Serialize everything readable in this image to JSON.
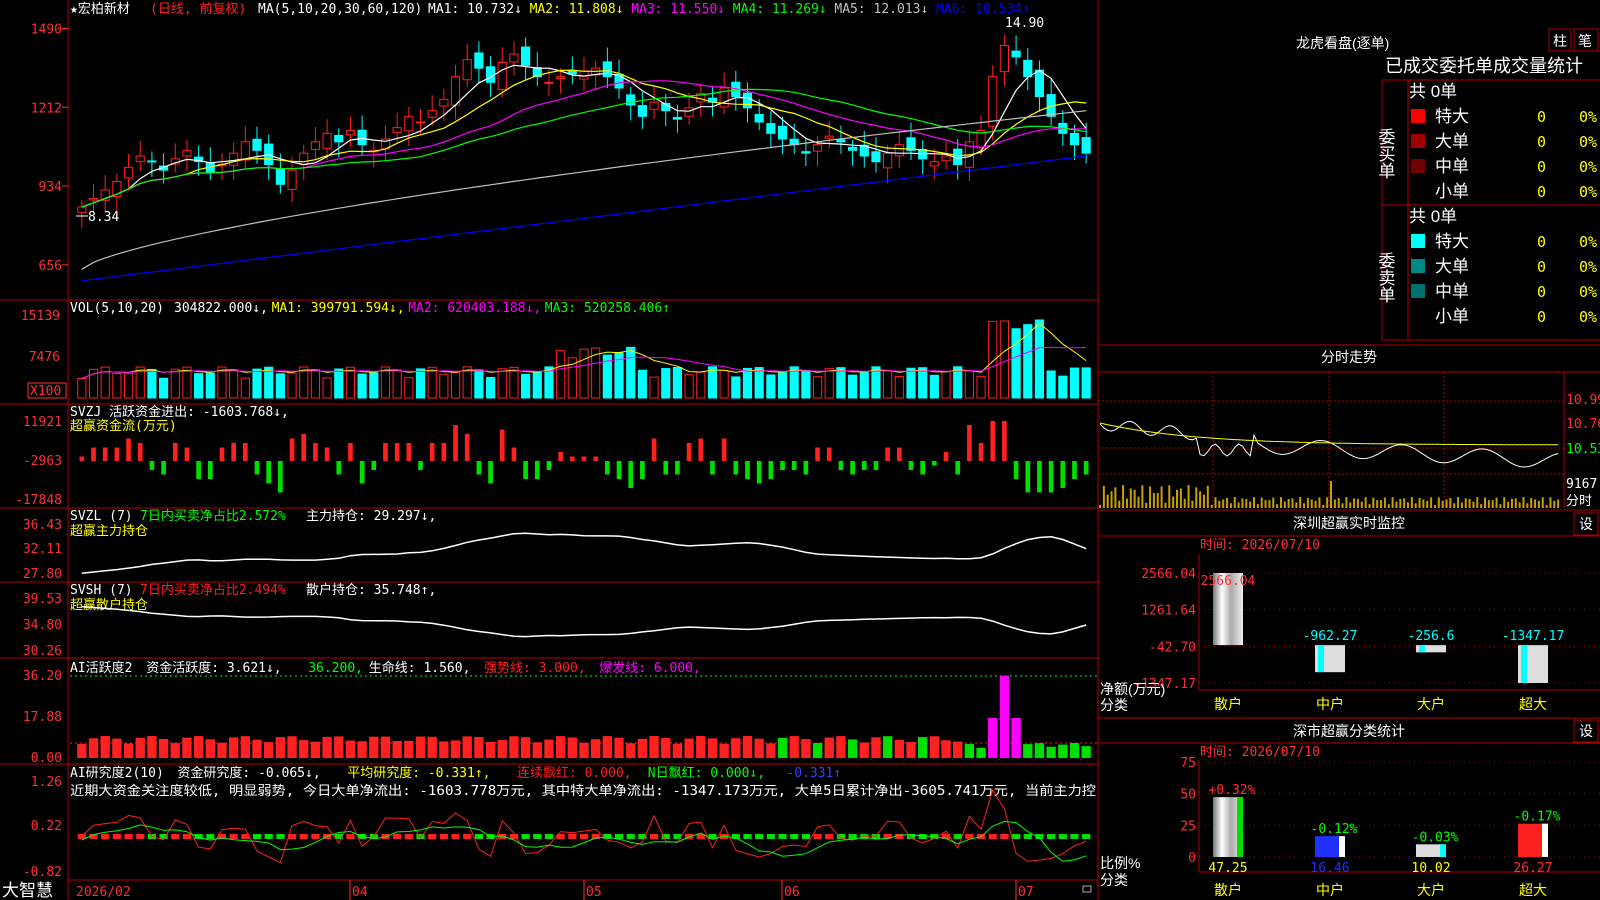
{
  "header": {
    "stock": "★宏柏新材",
    "mode": "(日线, 前复权)",
    "ma_title": "MA(5,10,20,30,60,120)",
    "ma": [
      {
        "text": "MA1: 10.732↓",
        "color": "#ffffff"
      },
      {
        "text": "MA2: 11.808↓",
        "color": "#ffff00"
      },
      {
        "text": "MA3: 11.550↓",
        "color": "#ff00ff"
      },
      {
        "text": "MA4: 11.269↓",
        "color": "#00ff00"
      },
      {
        "text": "MA5: 12.013↓",
        "color": "#c0c0c0"
      },
      {
        "text": "MA6: 10.534↑",
        "color": "#0000ff"
      }
    ]
  },
  "colors": {
    "up": "#ff2020",
    "down": "#00ffff",
    "grid": "#b00000",
    "axis_text": "#ff3030",
    "green": "#00e000",
    "yellow": "#ffff00",
    "magenta": "#ff00ff"
  },
  "price_panel": {
    "ticks": [
      "1490",
      "1212",
      "934",
      "656"
    ],
    "high_label": "14.90",
    "low_label": "8.34",
    "ylim": [
      5.6,
      15.2
    ],
    "closes": [
      8.6,
      8.9,
      9.2,
      9.5,
      10.0,
      10.4,
      10.2,
      9.9,
      10.3,
      10.6,
      10.2,
      9.8,
      10.1,
      10.5,
      10.9,
      10.6,
      10.1,
      9.4,
      9.9,
      10.5,
      10.9,
      11.2,
      10.9,
      11.3,
      10.8,
      10.6,
      11.0,
      11.4,
      11.8,
      11.6,
      12.0,
      12.4,
      13.2,
      13.8,
      13.5,
      13.0,
      13.7,
      14.0,
      13.6,
      13.2,
      13.0,
      13.2,
      13.3,
      13.4,
      13.5,
      13.2,
      12.8,
      12.2,
      11.8,
      12.3,
      12.0,
      11.7,
      12.1,
      12.6,
      12.3,
      12.8,
      12.5,
      12.1,
      11.6,
      11.2,
      11.0,
      10.8,
      10.5,
      10.8,
      11.1,
      10.9,
      10.6,
      10.4,
      10.2,
      10.5,
      10.8,
      10.6,
      10.3,
      10.2,
      10.4,
      10.1,
      10.9,
      11.3,
      13.2,
      14.3,
      13.9,
      13.2,
      12.5,
      11.8,
      11.2,
      10.8,
      10.5
    ]
  },
  "vol_panel": {
    "title": "VOL(5,10,20)",
    "items": [
      {
        "text": "304822.000↓,",
        "color": "#ffffff"
      },
      {
        "text": "MA1: 399791.594↓,",
        "color": "#ffff00"
      },
      {
        "text": "MA2: 620403.188↓,",
        "color": "#ff00ff"
      },
      {
        "text": "MA3: 520258.406↑",
        "color": "#00ff00"
      }
    ],
    "ticks": [
      "15139",
      "7476"
    ],
    "unit": "X100"
  },
  "svzj_panel": {
    "title": "SVZJ  活跃资金进出: -1603.768↓,",
    "subtitle": "超赢资金流(万元)",
    "ticks": [
      "11921",
      "-2963",
      "-17848"
    ]
  },
  "svzl_panel": {
    "title": "SVZL (7)",
    "pct": "7日内买卖净占比2.572%",
    "hold": "主力持仓: 29.297↓,",
    "subtitle": "超赢主力持仓",
    "ticks": [
      "36.43",
      "32.11",
      "27.80"
    ]
  },
  "svsh_panel": {
    "title": "SVSH (7)",
    "pct": "7日内买卖净占比2.494%",
    "hold": "散户持仓: 35.748↑,",
    "subtitle": "超赢散户持仓",
    "ticks": [
      "39.53",
      "34.80",
      "30.26"
    ]
  },
  "ai_active_panel": {
    "items": [
      {
        "text": "AI活跃度2",
        "color": "#ffffff"
      },
      {
        "text": "资金活跃度: 3.621↓,",
        "color": "#ffffff"
      },
      {
        "text": "36.200,",
        "color": "#00ff00"
      },
      {
        "text": "生命线: 1.560,",
        "color": "#ffffff"
      },
      {
        "text": "强势线: 3.000,",
        "color": "#ff2020"
      },
      {
        "text": "爆发线: 6.000,",
        "color": "#ff00ff"
      }
    ],
    "ticks": [
      "36.20",
      "17.88",
      "0.00"
    ]
  },
  "ai_research_panel": {
    "items": [
      {
        "text": "AI研究度2(10)",
        "color": "#ffffff"
      },
      {
        "text": "资金研究度: -0.065↓,",
        "color": "#ffffff"
      },
      {
        "text": "平均研究度: -0.331↑,",
        "color": "#ffff00"
      },
      {
        "text": "连续飘红: 0.000,",
        "color": "#ff2020"
      },
      {
        "text": "N日飘红: 0.000↓,",
        "color": "#00ff00"
      },
      {
        "text": "-0.331↑",
        "color": "#4040ff"
      }
    ],
    "comment": "近期大资金关注度较低, 明显弱势, 今日大单净流出: -1603.778万元, 其中特大单净流出: -1347.173万元, 大单5日累计净出-3605.741万元, 当前主力控",
    "ticks": [
      "1.26",
      "0.22",
      "-0.82"
    ]
  },
  "xaxis": {
    "app": "大智慧",
    "labels": [
      "2026/02",
      "04",
      "05",
      "06",
      "07"
    ]
  },
  "lhb": {
    "title": "龙虎看盘(逐单)",
    "btn_bar": "柱",
    "btn_pen": "笔",
    "subtitle": "已成交委托单成交量统计",
    "buy_label": "委买单",
    "sell_label": "委卖单",
    "buy_total": "共 0单",
    "sell_total": "共 0单",
    "buy_rows": [
      {
        "name": "特大",
        "count": "0",
        "pct": "0%",
        "color": "#ff0000"
      },
      {
        "name": "大单",
        "count": "0",
        "pct": "0%",
        "color": "#a00000"
      },
      {
        "name": "中单",
        "count": "0",
        "pct": "0%",
        "color": "#700000"
      },
      {
        "name": "小单",
        "count": "0",
        "pct": "0%",
        "color": "#000000"
      }
    ],
    "sell_rows": [
      {
        "name": "特大",
        "count": "0",
        "pct": "0%",
        "color": "#00ffff"
      },
      {
        "name": "大单",
        "count": "0",
        "pct": "0%",
        "color": "#008888"
      },
      {
        "name": "中单",
        "count": "0",
        "pct": "0%",
        "color": "#007070"
      },
      {
        "name": "小单",
        "count": "0",
        "pct": "0%",
        "color": "#000000"
      }
    ]
  },
  "intraday": {
    "title": "分时走势",
    "price_ticks": [
      "10.99",
      "10.76",
      "10.53"
    ],
    "vol_tick": "9167",
    "vol_label": "分时"
  },
  "chart_data": [
    {
      "type": "bar",
      "title": "深圳超赢实时监控",
      "time": "时间: 2026/07/10",
      "settings": "设",
      "ylabel": "净额(万元)",
      "xlabel": "分类",
      "ticks": [
        "2566.04",
        "1261.64",
        "-42.70",
        "-1347.17"
      ],
      "ylim": [
        -1347.17,
        2566.04
      ],
      "categories": [
        "散户",
        "中户",
        "大户",
        "超大"
      ],
      "values": [
        2566.04,
        -962.27,
        -256.6,
        -1347.17
      ],
      "value_labels": [
        "2566.04",
        "-962.27",
        "-256.6",
        "-1347.17"
      ]
    },
    {
      "type": "bar",
      "title": "深市超赢分类统计",
      "time": "时间: 2026/07/10",
      "settings": "设",
      "ylabel": "比例%",
      "xlabel": "分类",
      "ticks": [
        "75",
        "50",
        "25",
        "0"
      ],
      "ylim": [
        0,
        75
      ],
      "categories": [
        "散户",
        "中户",
        "大户",
        "超大"
      ],
      "values": [
        47.25,
        16.46,
        10.02,
        26.27
      ],
      "changes": [
        "+0.32%",
        "-0.12%",
        "-0.03%",
        "-0.17%"
      ]
    }
  ]
}
